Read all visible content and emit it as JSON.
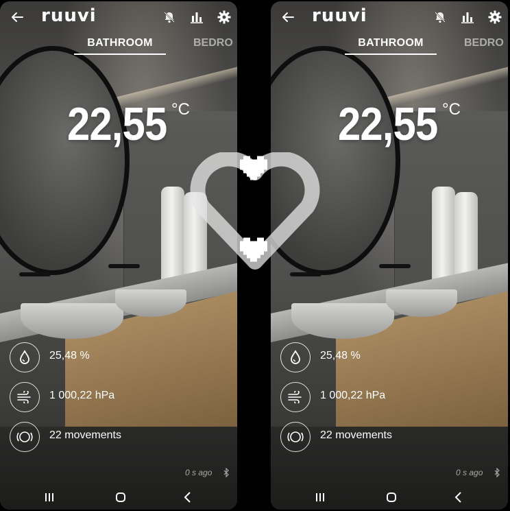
{
  "screens": [
    {
      "app_logo": "ruuvi",
      "tabs": {
        "active": "BATHROOM",
        "next": "BEDRO"
      },
      "temperature": {
        "value": "22,55",
        "unit": "°C"
      },
      "metrics": [
        {
          "icon": "droplet-icon",
          "label": "25,48 %"
        },
        {
          "icon": "wind-icon",
          "label": "1 000,22 hPa"
        },
        {
          "icon": "movement-icon",
          "label": "22 movements"
        }
      ],
      "updated": "0 s ago"
    },
    {
      "app_logo": "ruuvi",
      "tabs": {
        "active": "BATHROOM",
        "next": "BEDRO"
      },
      "temperature": {
        "value": "22,55",
        "unit": "°C"
      },
      "metrics": [
        {
          "icon": "droplet-icon",
          "label": "25,48 %"
        },
        {
          "icon": "wind-icon",
          "label": "1 000,22 hPa"
        },
        {
          "icon": "movement-icon",
          "label": "22 movements"
        }
      ],
      "updated": "0 s ago"
    }
  ],
  "colors": {
    "background": "#000000",
    "text": "#ffffff",
    "overlay_heart": "#d9d9d9"
  }
}
